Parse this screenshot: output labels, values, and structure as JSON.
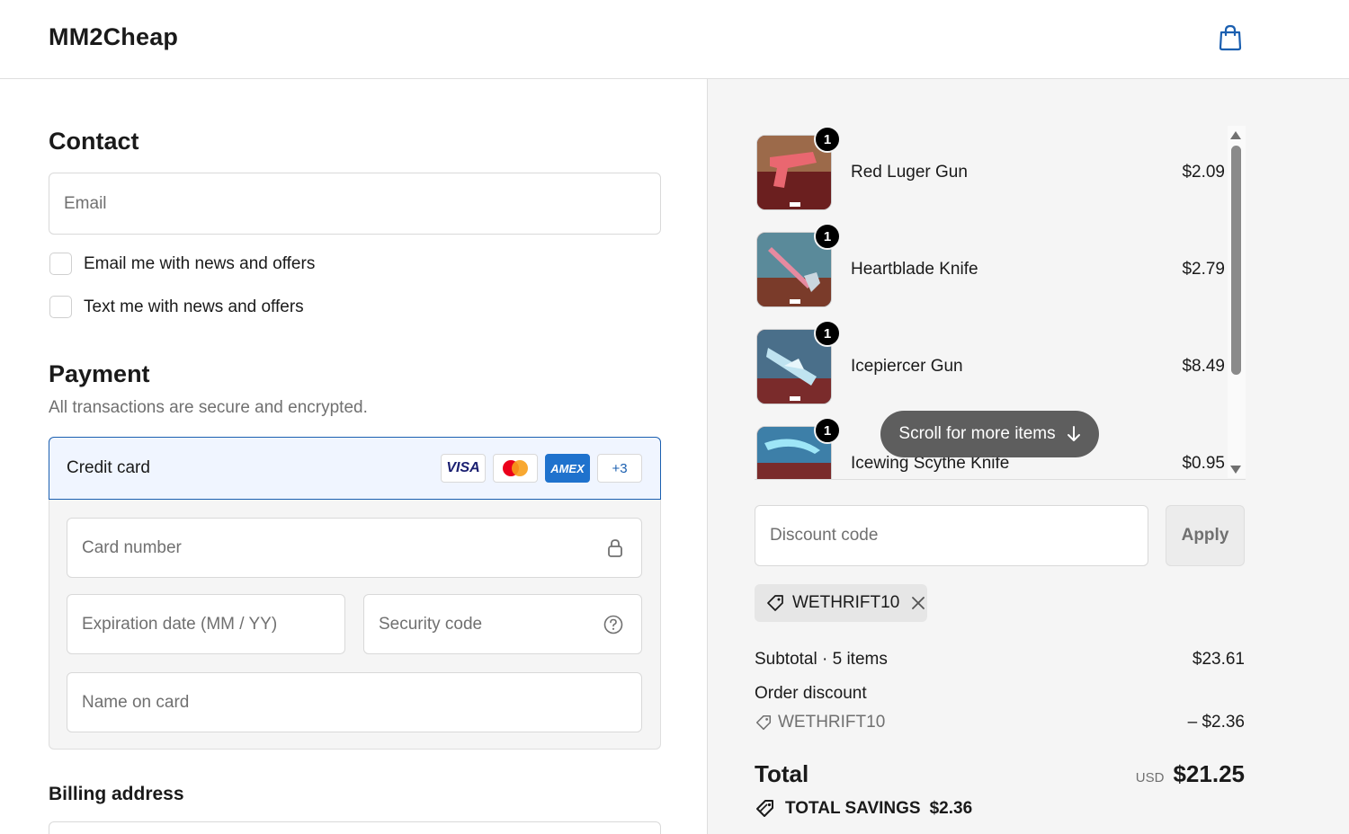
{
  "header": {
    "brand": "MM2Cheap",
    "cart_icon": "shopping-bag-icon"
  },
  "contact": {
    "title": "Contact",
    "email_placeholder": "Email",
    "email_optin_label": "Email me with news and offers",
    "text_optin_label": "Text me with news and offers"
  },
  "payment": {
    "title": "Payment",
    "subtitle": "All transactions are secure and encrypted.",
    "method_label": "Credit card",
    "logos": {
      "visa": "VISA",
      "amex": "AMEX",
      "more": "+3"
    },
    "card_number_placeholder": "Card number",
    "expiry_placeholder": "Expiration date (MM / YY)",
    "security_placeholder": "Security code",
    "name_placeholder": "Name on card"
  },
  "billing": {
    "title": "Billing address"
  },
  "order": {
    "items": [
      {
        "qty": "1",
        "name": "Red Luger Gun",
        "price": "$2.09"
      },
      {
        "qty": "1",
        "name": "Heartblade Knife",
        "price": "$2.79"
      },
      {
        "qty": "1",
        "name": "Icepiercer Gun",
        "price": "$8.49"
      },
      {
        "qty": "1",
        "name": "Icewing Scythe Knife",
        "price": "$0.95"
      }
    ],
    "scroll_hint": "Scroll for more items",
    "discount_placeholder": "Discount code",
    "apply_label": "Apply",
    "applied_code": "WETHRIFT10",
    "subtotal_label": "Subtotal · 5 items",
    "subtotal_value": "$23.61",
    "order_discount_label": "Order discount",
    "discount_code_line": "WETHRIFT10",
    "discount_value": "– $2.36",
    "total_label": "Total",
    "currency": "USD",
    "total_value": "$21.25",
    "savings_label": "TOTAL SAVINGS",
    "savings_value": "$2.36"
  },
  "colors": {
    "accent": "#1b5fb0",
    "summary_bg": "#f5f5f5",
    "cart_icon": "#1b5fb0"
  }
}
